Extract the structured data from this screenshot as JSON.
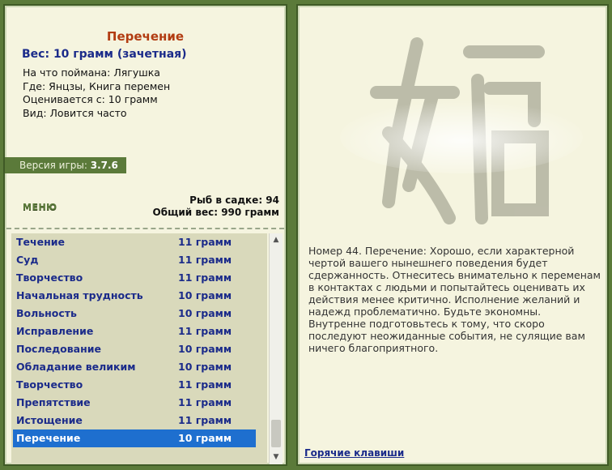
{
  "fish": {
    "title": "Перечение",
    "weight": "Вес: 10 грамм (зачетная)",
    "caught_on": "На что поймана: Лягушка",
    "where": "Где: Янцзы, Книга перемен",
    "rated_from": "Оценивается с: 10 грамм",
    "kind": "Вид: Ловится часто"
  },
  "version": {
    "label": "Версия игры:",
    "value": "3.7.6"
  },
  "menu_label": "МЕНЮ",
  "stats": {
    "fish_in_net": "Рыб в садке: 94",
    "total_weight": "Общий вес: 990 грамм"
  },
  "list": [
    {
      "name": "Течение",
      "weight": "11 грамм"
    },
    {
      "name": "Суд",
      "weight": "11 грамм"
    },
    {
      "name": "Творчество",
      "weight": "11 грамм"
    },
    {
      "name": "Начальная трудность",
      "weight": "10 грамм"
    },
    {
      "name": "Вольность",
      "weight": "10 грамм"
    },
    {
      "name": "Исправление",
      "weight": "11 грамм"
    },
    {
      "name": "Последование",
      "weight": "10 грамм"
    },
    {
      "name": "Обладание великим",
      "weight": "10 грамм"
    },
    {
      "name": "Творчество",
      "weight": "11 грамм"
    },
    {
      "name": "Препятствие",
      "weight": "11 грамм"
    },
    {
      "name": "Истощение",
      "weight": "11 грамм"
    },
    {
      "name": "Перечение",
      "weight": "10 грамм",
      "selected": true
    }
  ],
  "oracle_text": "Номер 44. Перечение: Хорошо, если характерной чертой вашего нынешнего поведения будет сдержанность. Отнеситесь внимательно к переменам в контактах с людьми и попытайтесь оценивать их действия менее критично. Исполнение желаний и надежд проблематично. Будьте экономны. Внутренне подготовьтесь к тому, что скоро последуют неожиданные события, не сулящие вам ничего благоприятного.",
  "hotkeys_label": "Горячие клавиши",
  "colors": {
    "accent": "#5b7a3a",
    "selected": "#1e6fcf",
    "title": "#b23c12",
    "link": "#1b2b8a"
  },
  "icons": {
    "scroll_up": "arrow-up-icon",
    "scroll_down": "arrow-down-icon",
    "hieroglyph": "hexagram-44-glyph"
  }
}
